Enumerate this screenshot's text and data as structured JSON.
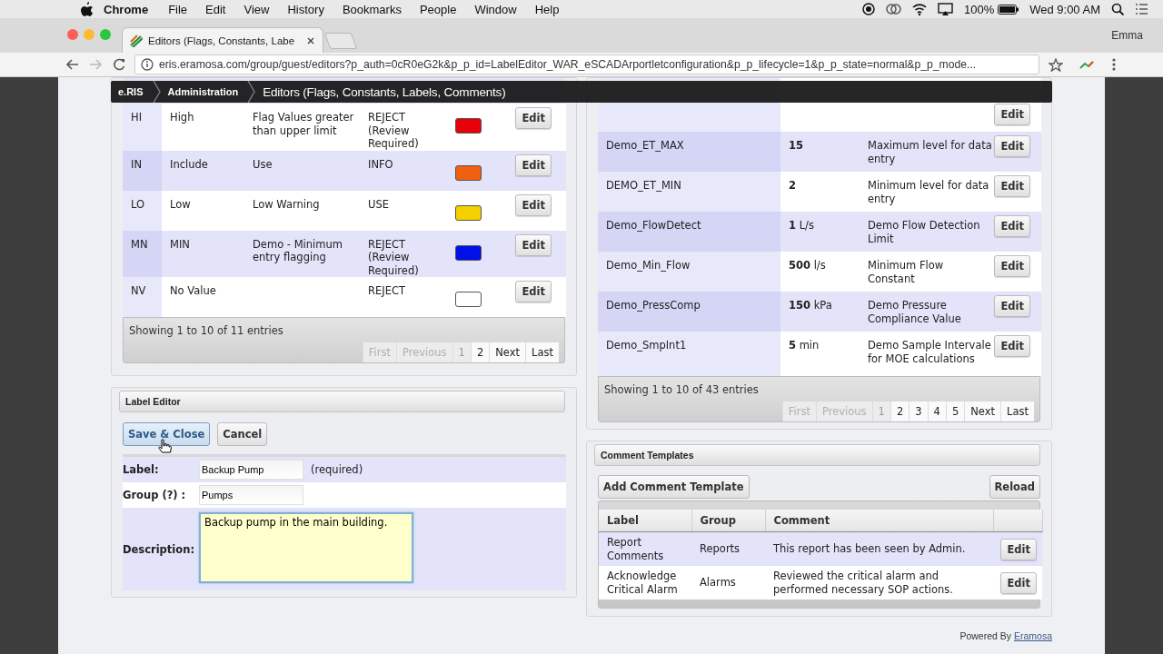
{
  "menubar": {
    "app": "Chrome",
    "menus": [
      "File",
      "Edit",
      "View",
      "History",
      "Bookmarks",
      "People",
      "Window",
      "Help"
    ],
    "battery": "100%",
    "clock": "Wed 9:00 AM"
  },
  "browser": {
    "tab_title": "Editors (Flags, Constants, Labe",
    "user": "Emma",
    "url": "eris.eramosa.com/group/guest/editors?p_auth=0cR0eG2k&p_p_id=LabelEditor_WAR_eSCADArportletconfiguration&p_p_lifecycle=1&p_p_state=normal&p_p_mode..."
  },
  "breadcrumb": [
    "e.RIS",
    "Administration",
    "Editors (Flags, Constants, Labels, Comments)"
  ],
  "flags": {
    "rows": [
      {
        "code": "HI",
        "name": "High",
        "description": "Flag Values greater than upper limit",
        "action": "REJECT (Review Required)",
        "color": "#e8000b",
        "button": "Edit"
      },
      {
        "code": "IN",
        "name": "Include",
        "description": "Use",
        "action": "INFO",
        "color": "#f06010",
        "button": "Edit"
      },
      {
        "code": "LO",
        "name": "Low",
        "description": "Low Warning",
        "action": "USE",
        "color": "#f5d000",
        "button": "Edit"
      },
      {
        "code": "MN",
        "name": "MIN",
        "description": "Demo - Minimum entry flagging",
        "action": "REJECT (Review Required)",
        "color": "#0010e8",
        "button": "Edit"
      },
      {
        "code": "NV",
        "name": "No Value",
        "action": "REJECT",
        "color": "#ffffff",
        "button": "Edit"
      }
    ],
    "info": "Showing 1 to 10 of 11 entries",
    "pages": [
      {
        "label": "First",
        "selected": false,
        "disabled": true
      },
      {
        "label": "Previous",
        "selected": false,
        "disabled": true
      },
      {
        "label": "1",
        "selected": true,
        "disabled": false
      },
      {
        "label": "2",
        "selected": false,
        "disabled": false
      },
      {
        "label": "Next",
        "selected": false,
        "disabled": false
      },
      {
        "label": "Last",
        "selected": false,
        "disabled": false
      }
    ]
  },
  "constants": {
    "partial_row_button": "Edit",
    "rows": [
      {
        "name": "Demo_ET_MAX",
        "value": "15",
        "description": "Maximum level for data entry",
        "button": "Edit"
      },
      {
        "name": "DEMO_ET_MIN",
        "value": "2",
        "description": "Minimum level for data entry",
        "button": "Edit"
      },
      {
        "name": "Demo_FlowDetect",
        "value": "1",
        "unit": "L/s",
        "description": "Demo Flow Detection Limit",
        "button": "Edit"
      },
      {
        "name": "Demo_Min_Flow",
        "value": "500",
        "unit": "l/s",
        "description": "Minimum Flow Constant",
        "button": "Edit"
      },
      {
        "name": "Demo_PressComp",
        "value": "150",
        "unit": "kPa",
        "description": "Demo Pressure Compliance Value",
        "button": "Edit"
      },
      {
        "name": "Demo_SmpInt1",
        "value": "5",
        "unit": "min",
        "description": "Demo Sample Intervale for MOE calculations",
        "button": "Edit"
      }
    ],
    "info": "Showing 1 to 10 of 43 entries",
    "pages": [
      {
        "label": "First",
        "selected": false,
        "disabled": true
      },
      {
        "label": "Previous",
        "selected": false,
        "disabled": true
      },
      {
        "label": "1",
        "selected": true,
        "disabled": false
      },
      {
        "label": "2",
        "selected": false,
        "disabled": false
      },
      {
        "label": "3",
        "selected": false,
        "disabled": false
      },
      {
        "label": "4",
        "selected": false,
        "disabled": false
      },
      {
        "label": "5",
        "selected": false,
        "disabled": false
      },
      {
        "label": "Next",
        "selected": false,
        "disabled": false
      },
      {
        "label": "Last",
        "selected": false,
        "disabled": false
      }
    ]
  },
  "label_editor": {
    "title": "Label Editor",
    "buttons": [
      {
        "label": "Save & Close",
        "hovered": true
      },
      {
        "label": "Cancel",
        "hovered": false
      }
    ],
    "fields": [
      {
        "kind": "text",
        "label": "Label:",
        "value": "Backup Pump",
        "note": "(required)"
      },
      {
        "kind": "text",
        "label": "Group (?) :",
        "value": "Pumps"
      },
      {
        "kind": "textarea",
        "label": "Description:",
        "value": "Backup pump in the main building.",
        "focused": true
      }
    ]
  },
  "comment_templates": {
    "title": "Comment Templates",
    "add_button": "Add Comment Template",
    "reload_button": "Reload",
    "columns": [
      "Label",
      "Group",
      "Comment"
    ],
    "rows": [
      {
        "label": "Report Comments",
        "group": "Reports",
        "comment": "This report has been seen by Admin.",
        "button": "Edit"
      },
      {
        "label": "Acknowledge Critical Alarm",
        "group": "Alarms",
        "comment": "Reviewed the critical alarm and performed necessary SOP actions.",
        "button": "Edit"
      }
    ]
  },
  "footer": {
    "text": "Powered By",
    "link": "Eramosa"
  }
}
